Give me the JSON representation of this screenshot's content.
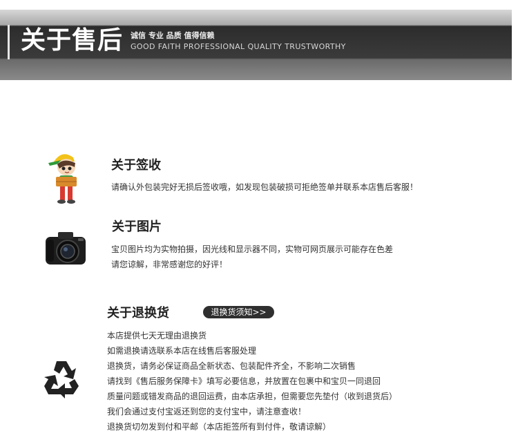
{
  "banner": {
    "title": "关于售后",
    "subtitle_cn": "诚信 专业 品质 值得信赖",
    "subtitle_en": "GOOD FAITH PROFESSIONAL QUALITY TRUSTWORTHY"
  },
  "sections": {
    "receipt": {
      "title": "关于签收",
      "lines": [
        "请确认外包装完好无损后签收哦，如发现包装破损可拒绝签单并联系本店售后客服！"
      ]
    },
    "photos": {
      "title": "关于图片",
      "lines": [
        "宝贝图片均为实物拍摄，因光线和显示器不同，实物可网页展示可能存在色差",
        "请您谅解，非常感谢您的好评！"
      ]
    },
    "returns": {
      "title": "关于退换货",
      "button_label": "退换货须知>>",
      "lines": [
        "本店提供七天无理由退换货",
        "如需退换请选联系本店在线售后客服处理",
        "退换货，请务必保证商品全新状态、包装配件齐全，不影响二次销售",
        "请找到《售后服务保障卡》填写必要信息，并放置在包裹中和宝贝一同退回",
        "质量问题或错发商品的退回运费，由本店承担，但需要您先垫付（收到退货后）",
        "我们会通过支付宝返还到您的支付宝中，请注意查收！",
        "退换货切勿发到付和平邮（本店拒签所有到付件，敬请谅解）"
      ]
    }
  },
  "icons": {
    "receipt": "delivery-boy-icon",
    "photos": "camera-icon",
    "returns": "recycle-icon"
  },
  "colors": {
    "banner_dark": "#333333",
    "pill": "#2f2f2f"
  }
}
